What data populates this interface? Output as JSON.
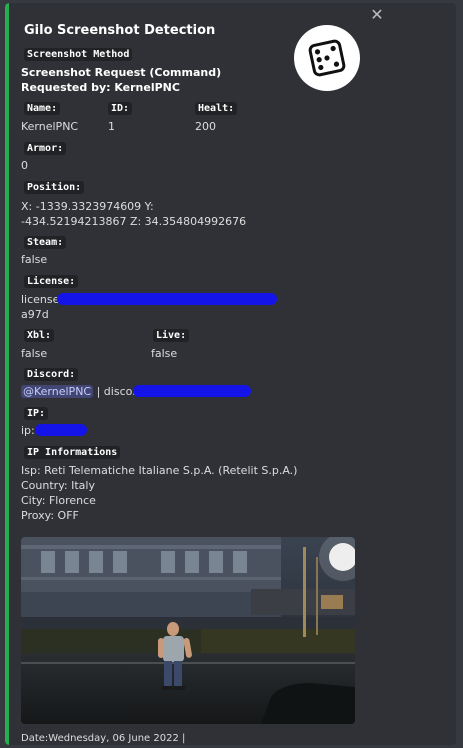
{
  "embed": {
    "title": "Gilo Screenshot Detection",
    "accent_color": "#27ae4f",
    "thumbnail_icon": "dice-icon",
    "close_icon": "close-icon"
  },
  "fields": {
    "screenshot_method": {
      "name": "Screenshot Method",
      "value": "Screenshot Request (Command) Requested by: KernelPNC"
    },
    "name": {
      "name": "Name:",
      "value": "KernelPNC"
    },
    "id": {
      "name": "ID:",
      "value": "1"
    },
    "health": {
      "name": "Healt:",
      "value": "200"
    },
    "armor": {
      "name": "Armor:",
      "value": "0"
    },
    "position": {
      "name": "Position:",
      "value": "X: -1339.3323974609 Y: -434.52194213867 Z: 34.354804992676"
    },
    "steam": {
      "name": "Steam:",
      "value": "false"
    },
    "license": {
      "name": "License:",
      "value_prefix": "license:",
      "value_suffix": "a97d"
    },
    "xbl": {
      "name": "Xbl:",
      "value": "false"
    },
    "live": {
      "name": "Live:",
      "value": "false"
    },
    "discord": {
      "name": "Discord:",
      "mention": "@KernelPNC",
      "sep": " | discord:"
    },
    "ip": {
      "name": "IP:",
      "value_prefix": "ip:"
    },
    "ip_info": {
      "name": "IP Informations",
      "isp": "Isp: Reti Telematiche Italiane S.p.A. (Retelit S.p.A.)",
      "country": "Country: Italy",
      "city": "City: Florence",
      "proxy": "Proxy: OFF"
    }
  },
  "footer": {
    "text": "Date:Wednesday, 06 June 2022 |"
  }
}
